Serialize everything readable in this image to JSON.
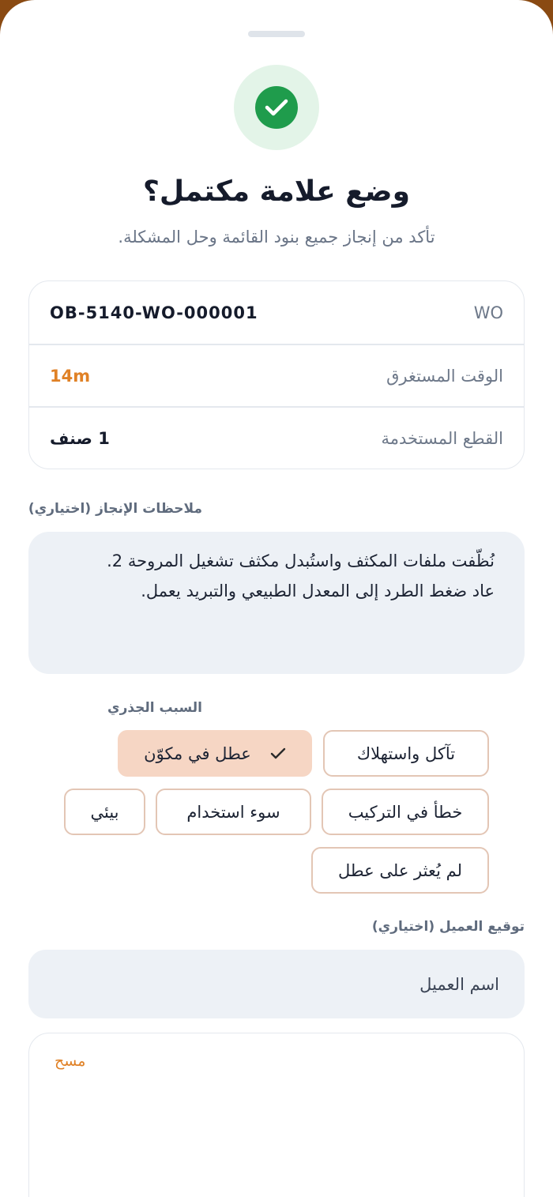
{
  "header": {
    "title": "وضع علامة مكتمل؟",
    "subtitle": "تأكد من إنجاز جميع بنود القائمة وحل المشكلة."
  },
  "summary": {
    "rows": [
      {
        "label": "WO",
        "value": "OB-5140-WO-000001"
      },
      {
        "label": "الوقت المستغرق",
        "value": "14m"
      },
      {
        "label": "القطع المستخدمة",
        "value": "1 صنف"
      }
    ]
  },
  "notes": {
    "label": "ملاحظات الإنجاز (اختياري)",
    "line1": "نُظّفت ملفات المكثف واستُبدل مكثف تشغيل المروحة 2.",
    "line2": "عاد ضغط الطرد إلى المعدل الطبيعي والتبريد يعمل."
  },
  "root_cause": {
    "label": "السبب الجذري",
    "options": [
      {
        "label": "تآكل واستهلاك",
        "selected": false
      },
      {
        "label": "عطل في مكوّن",
        "selected": true
      },
      {
        "label": "خطأ في التركيب",
        "selected": false
      },
      {
        "label": "سوء استخدام",
        "selected": false
      },
      {
        "label": "بيئي",
        "selected": false
      },
      {
        "label": "لم يُعثر على عطل",
        "selected": false
      }
    ]
  },
  "signature": {
    "label": "توقيع العميل (اختياري)",
    "client_name_placeholder": "اسم العميل",
    "clear_label": "مسح"
  },
  "colors": {
    "accent": "#e08126",
    "success": "#1f9c4c",
    "selected_chip": "#f6d6c4"
  },
  "icons": {
    "success": "check-circle-icon",
    "chip_check": "check-icon"
  }
}
